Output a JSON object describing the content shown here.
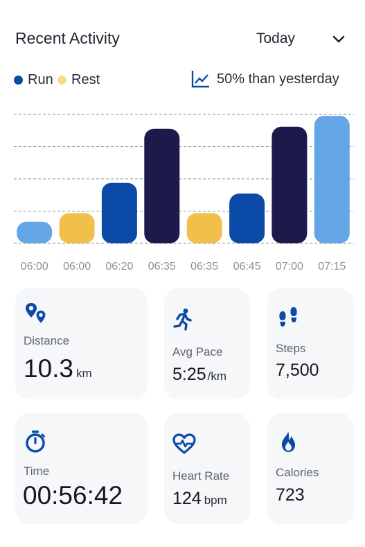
{
  "header": {
    "title": "Recent Activity",
    "period": "Today"
  },
  "legend": {
    "items": [
      {
        "label": "Run",
        "color": "#0b4aa6"
      },
      {
        "label": "Rest",
        "color": "#f7db8a"
      }
    ],
    "trend_text": "50% than yesterday"
  },
  "chart_data": {
    "type": "bar",
    "categories": [
      "06:00",
      "06:00",
      "06:20",
      "06:35",
      "06:35",
      "06:45",
      "07:00",
      "07:15"
    ],
    "values": [
      1,
      1.4,
      2.8,
      5.3,
      1.4,
      2.3,
      5.4,
      5.9
    ],
    "colors": [
      "#64a6e6",
      "#f1c04a",
      "#0b4aa6",
      "#1b1a4b",
      "#f1c04a",
      "#0b4aa6",
      "#1b1a4b",
      "#64a6e6"
    ],
    "ylim": [
      0,
      6
    ],
    "grid": true
  },
  "stats": {
    "distance": {
      "label": "Distance",
      "value": "10.3",
      "unit": "km"
    },
    "pace": {
      "label": "Avg Pace",
      "value": "5:25",
      "unit": "/km"
    },
    "steps": {
      "label": "Steps",
      "value": "7,500"
    },
    "time": {
      "label": "Time",
      "value": "00:56:42"
    },
    "heart": {
      "label": "Heart Rate",
      "value": "124",
      "unit": "bpm"
    },
    "calories": {
      "label": "Calories",
      "value": "723"
    }
  },
  "icons": {
    "distance": "map-pins-icon",
    "pace": "runner-icon",
    "steps": "footsteps-icon",
    "time": "stopwatch-icon",
    "heart": "heart-pulse-icon",
    "calories": "flame-icon"
  },
  "colors": {
    "accent": "#0b4aa6",
    "tile_bg": "#f6f7f9"
  }
}
